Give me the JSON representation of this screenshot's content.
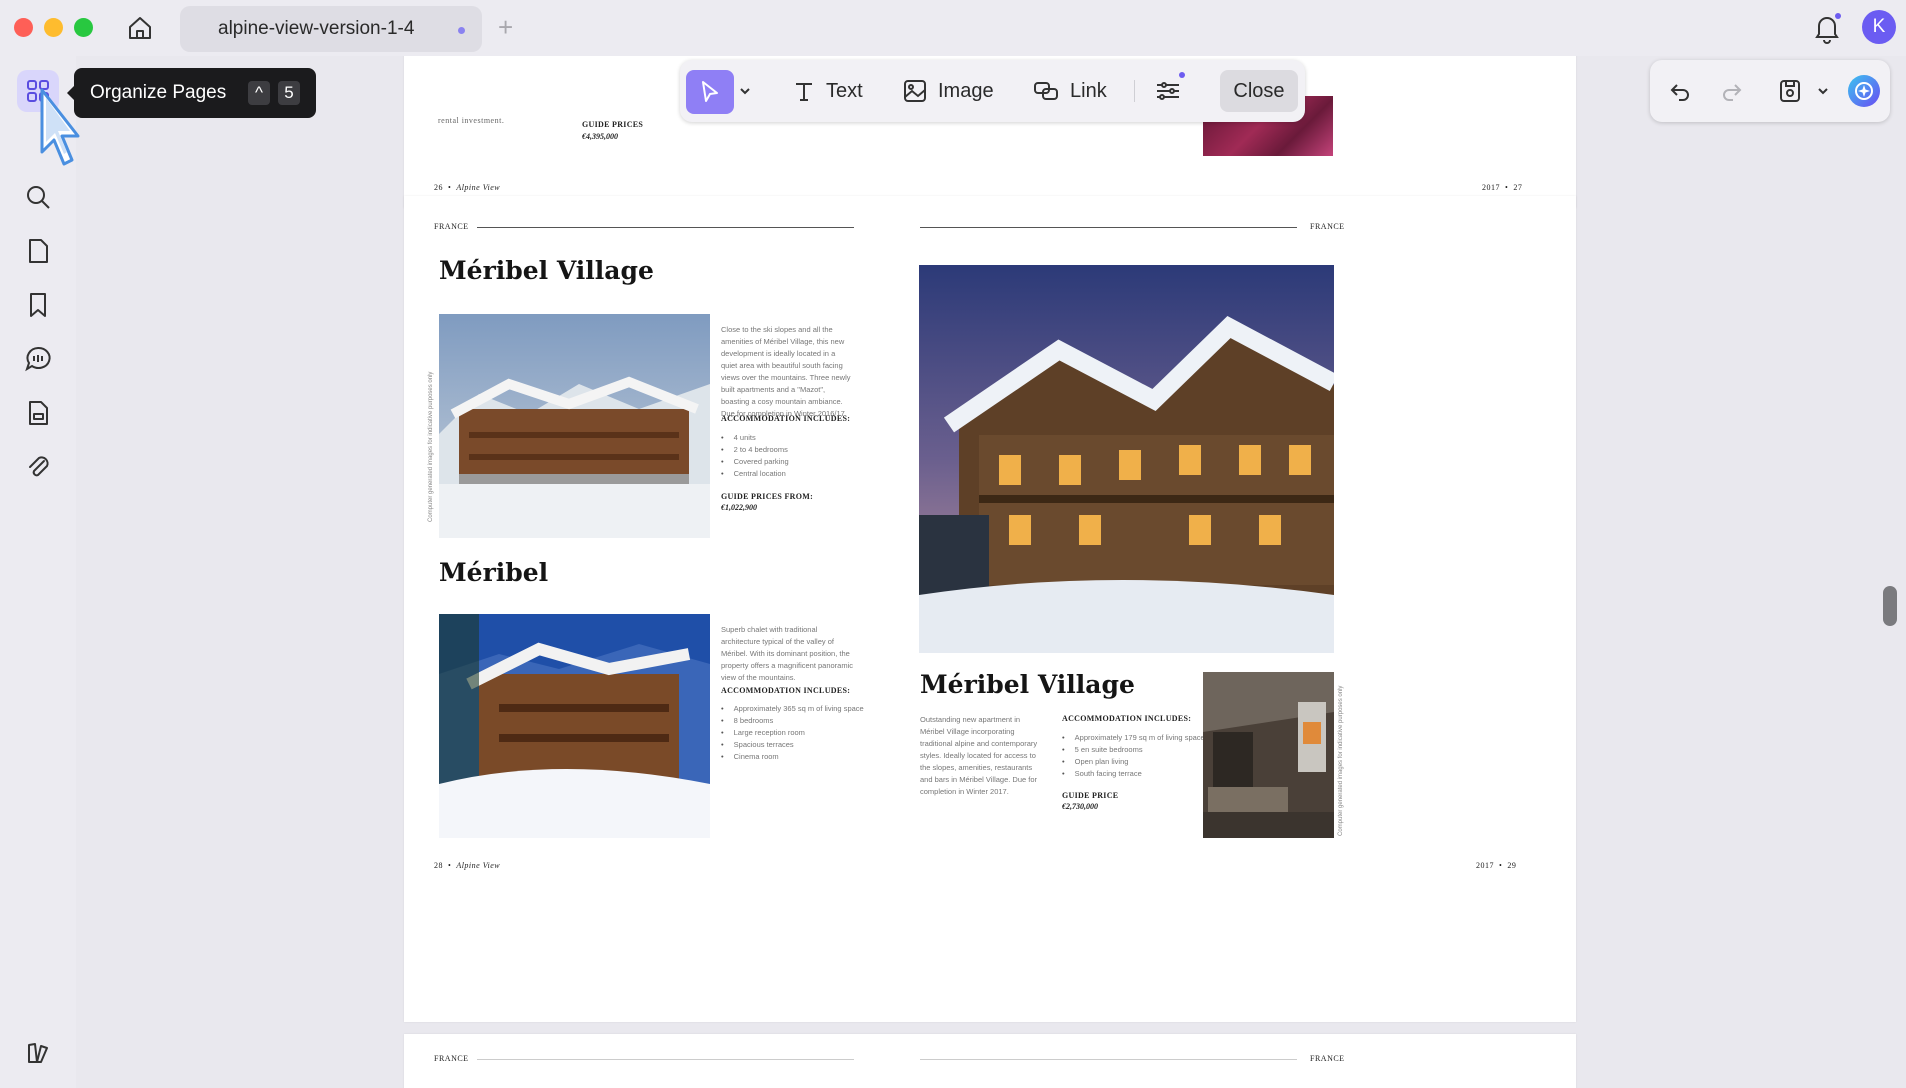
{
  "window": {
    "tab_title": "alpine-view-version-1-4",
    "avatar_initial": "K"
  },
  "tooltip": {
    "label": "Organize Pages",
    "shortcut_modifier": "^",
    "shortcut_key": "5"
  },
  "toolbar": {
    "text_label": "Text",
    "image_label": "Image",
    "link_label": "Link",
    "close_label": "Close"
  },
  "rail": {
    "items": [
      "organize-pages",
      "search",
      "pages",
      "bookmarks",
      "comments",
      "forms",
      "attachments",
      "themes"
    ]
  },
  "top_page": {
    "left_snippet": "rental investment.",
    "guide_label": "GUIDE PRICES",
    "guide_price": "€4,395,000",
    "footer_left_num": "26",
    "footer_left_pub": "Alpine View",
    "footer_right_year": "2017",
    "footer_right_num": "27"
  },
  "spread": {
    "country_left": "FRANCE",
    "country_right": "FRANCE",
    "block1": {
      "title": "Méribel Village",
      "desc": "Close to the ski slopes and all the amenities of Méribel Village, this new development is ideally located in a quiet area with beautiful south facing views over the mountains. Three newly built apartments and a \"Mazot\", boasting a cosy mountain ambiance. Due for completion in Winter 2016/17",
      "accommodation_label": "ACCOMMODATION INCLUDES:",
      "bullets": [
        "4 units",
        "2 to 4 bedrooms",
        "Covered parking",
        "Central location"
      ],
      "guide_label": "GUIDE PRICES FROM:",
      "guide_price": "€1,022,900",
      "disclaimer": "Computer generated images for indicative purposes only"
    },
    "block2": {
      "title": "Méribel",
      "desc": "Superb chalet with traditional architecture typical of the valley of Méribel. With its dominant position, the property offers a magnificent panoramic view of the mountains.",
      "accommodation_label": "ACCOMMODATION INCLUDES:",
      "bullets": [
        "Approximately 365 sq m of living space",
        "8 bedrooms",
        "Large reception room",
        "Spacious terraces",
        "Cinema room"
      ]
    },
    "block3": {
      "title": "Méribel Village",
      "desc": "Outstanding new apartment in Méribel Village incorporating traditional alpine and contemporary styles. Ideally located for access to the slopes, amenities, restaurants and bars in Méribel Village. Due for completion in Winter 2017.",
      "accommodation_label": "ACCOMMODATION INCLUDES:",
      "bullets": [
        "Approximately 179 sq m of living space",
        "5 en suite bedrooms",
        "Open plan living",
        "South facing terrace"
      ],
      "guide_label": "GUIDE PRICE",
      "guide_price": "€2,730,000",
      "disclaimer": "Computer generated images for indicative purposes only"
    },
    "footer_left_num": "28",
    "footer_left_pub": "Alpine View",
    "footer_right_year": "2017",
    "footer_right_num": "29"
  },
  "bottom_page": {
    "country_left": "FRANCE",
    "country_right": "FRANCE"
  },
  "colors": {
    "accent": "#8f7ff5",
    "tooltip_bg": "#1b1b1d",
    "canvas": "#e9e8ee"
  }
}
